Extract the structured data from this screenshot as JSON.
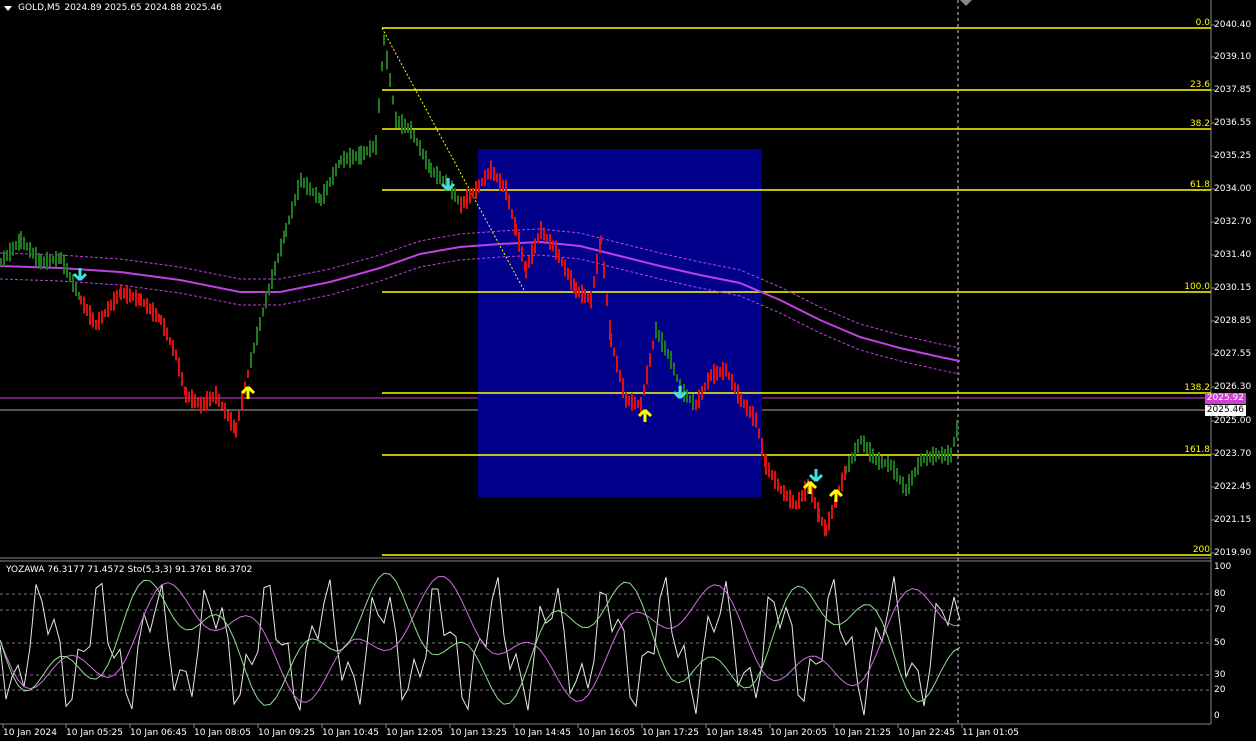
{
  "symbol_header": {
    "symbol": "GOLD,M5",
    "ohlc": "2024.89 2025.65 2024.88 2025.46"
  },
  "oscillator_header": {
    "text": "YOZAWA 76.3177 71.4572  Sto(5,3,3) 91.3761 86.3702"
  },
  "price_axis": [
    "2040.40",
    "2039.10",
    "2037.85",
    "2036.55",
    "2035.25",
    "2034.00",
    "2032.70",
    "2031.40",
    "2030.15",
    "2028.85",
    "2027.55",
    "2026.30",
    "2025.00",
    "2023.70",
    "2022.45",
    "2021.15",
    "2019.90"
  ],
  "osc_axis": [
    "100",
    "80",
    "70",
    "50",
    "30",
    "20",
    "0"
  ],
  "time_axis": [
    "10 Jan 2024",
    "10 Jan 05:25",
    "10 Jan 06:45",
    "10 Jan 08:05",
    "10 Jan 09:25",
    "10 Jan 10:45",
    "10 Jan 12:05",
    "10 Jan 13:25",
    "10 Jan 14:45",
    "10 Jan 16:05",
    "10 Jan 17:25",
    "10 Jan 18:45",
    "10 Jan 20:05",
    "10 Jan 21:25",
    "10 Jan 22:45",
    "11 Jan 01:05"
  ],
  "fib_levels": [
    "0.0",
    "23.6",
    "38.2",
    "61.8",
    "100.0",
    "138.2",
    "161.8",
    "200"
  ],
  "price_tags": {
    "ma_price": "2025.92",
    "current_price": "2025.46"
  },
  "colors": {
    "background": "#000000",
    "bull_bar": "#1f7a1f",
    "bear_bar": "#e01010",
    "fib_line": "#ffff00",
    "rect_fill": "#00008b",
    "ma_line": "#c040e0",
    "ma_tag": "#d040d0",
    "arrow_up": "#ffff00",
    "arrow_down": "#40e0e0"
  },
  "icons": {
    "buy": "up-arrow-icon",
    "sell": "down-arrow-icon",
    "menu": "dropdown-triangle-icon"
  }
}
